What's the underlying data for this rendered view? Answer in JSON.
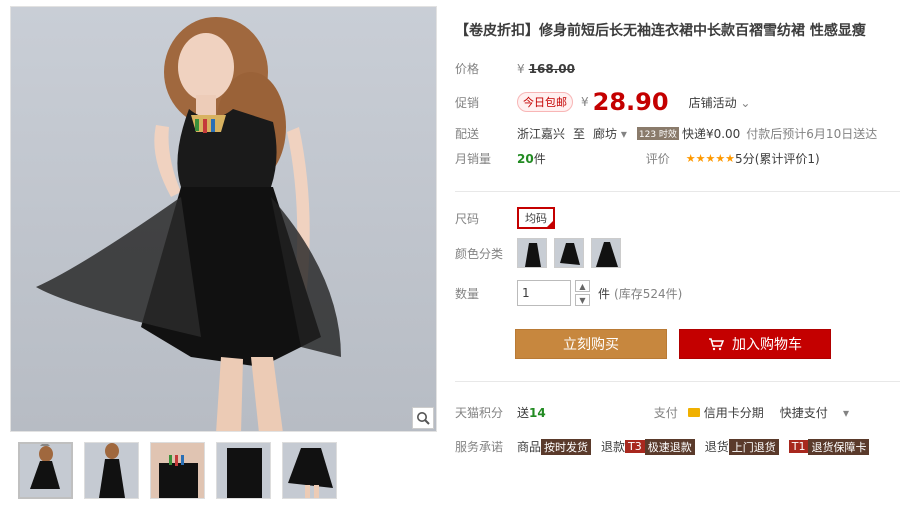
{
  "product": {
    "title": "【卷皮折扣】修身前短后长无袖连衣裙中长款百褶雪纺裙 性感显瘦"
  },
  "price": {
    "label": "价格",
    "currency": "¥",
    "original": "168.00"
  },
  "promo": {
    "label": "促销",
    "badge": "今日包邮",
    "currency": "¥",
    "price": "28.90",
    "activity": "店铺活动"
  },
  "shipping": {
    "label": "配送",
    "from": "浙江嘉兴",
    "to_word": "至",
    "destination": "廊坊",
    "speed_badge": "123 时效",
    "express": "快递¥0.00",
    "eta": "付款后预计6月10日送达"
  },
  "sales": {
    "label": "月销量",
    "count": "20",
    "unit": "件",
    "review_label": "评价",
    "stars": "★★★★★",
    "score": "5分",
    "review_count": "(累计评价1)"
  },
  "size": {
    "label": "尺码",
    "value": "均码"
  },
  "color": {
    "label": "颜色分类"
  },
  "quantity": {
    "label": "数量",
    "value": "1",
    "unit": "件",
    "stock": "(库存524件)"
  },
  "buttons": {
    "buy": "立刻购买",
    "cart": "加入购物车"
  },
  "points": {
    "label": "天猫积分",
    "prefix": "送",
    "value": "14",
    "pay_label": "支付",
    "credit": "信用卡分期",
    "quick": "快捷支付"
  },
  "service": {
    "label": "服务承诺",
    "goods_prefix": "商品",
    "goods_tag": "按时发货",
    "refund_prefix": "退款",
    "refund_t": "T3",
    "refund_tag": "极速退款",
    "return_prefix": "退货",
    "return_tag": "上门退货",
    "card_t": "T1",
    "card_tag": "退货保障卡"
  }
}
